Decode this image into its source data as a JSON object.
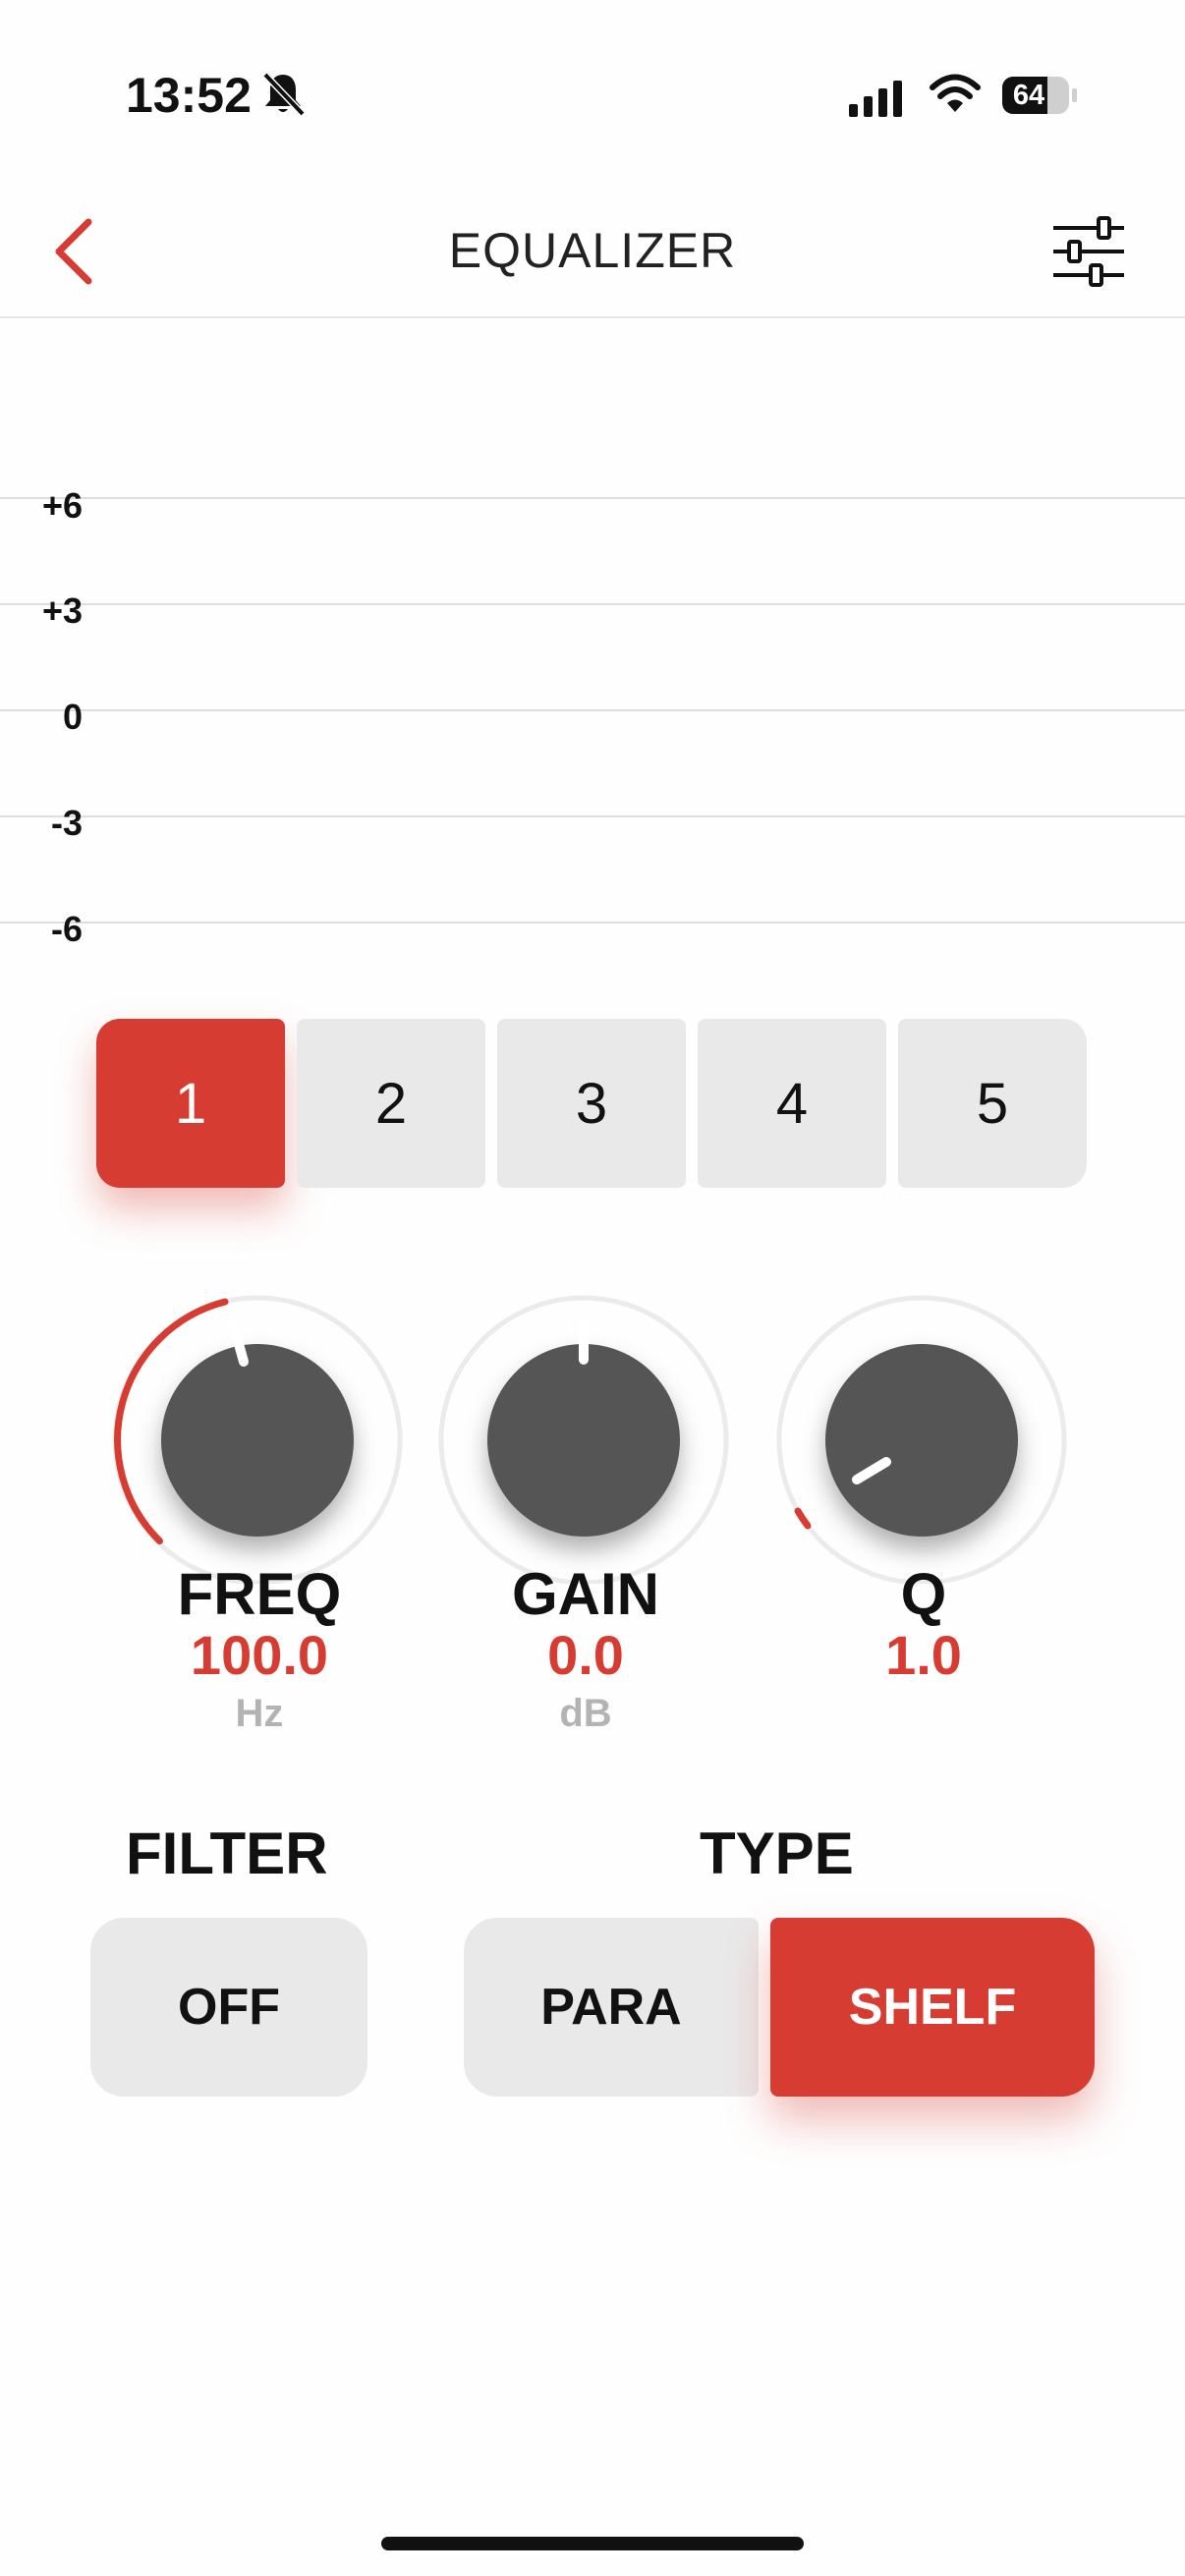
{
  "status_bar": {
    "time": "13:52",
    "battery": "64"
  },
  "nav": {
    "title": "EQUALIZER"
  },
  "graph": {
    "y_labels": [
      "+6",
      "+3",
      "0",
      "-3",
      "-6"
    ]
  },
  "bands": {
    "items": [
      "1",
      "2",
      "3",
      "4",
      "5"
    ],
    "selected": "1"
  },
  "knobs": {
    "freq": {
      "label": "FREQ",
      "value": "100.0",
      "unit": "Hz"
    },
    "gain": {
      "label": "GAIN",
      "value": "0.0",
      "unit": "dB"
    },
    "q": {
      "label": "Q",
      "value": "1.0"
    }
  },
  "filter": {
    "label": "FILTER",
    "button": "OFF"
  },
  "type": {
    "label": "TYPE",
    "options": [
      "PARA",
      "SHELF"
    ],
    "selected": "SHELF"
  },
  "colors": {
    "accent": "#d63c31",
    "button_bg": "#e9e9e9",
    "knob": "#555555"
  }
}
